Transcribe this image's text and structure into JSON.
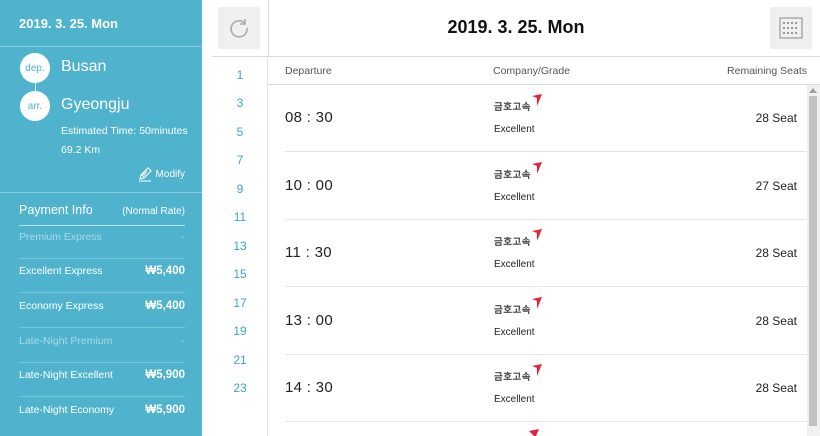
{
  "sidebar": {
    "date": "2019. 3. 25. Mon",
    "dep_badge": "dep.",
    "departure": "Busan",
    "arr_badge": "arr.",
    "arrival": "Gyeongju",
    "estimated_time": "Estimated Time: 50minutes",
    "distance": "69.2 Km",
    "modify_label": "Modify",
    "payment_title": "Payment Info",
    "rate_label": "(Normal Rate)",
    "fares": [
      {
        "name": "Premium Express",
        "price": "-"
      },
      {
        "name": "Excellent Express",
        "price": "₩5,400"
      },
      {
        "name": "Economy Express",
        "price": "₩5,400"
      },
      {
        "name": "Late-Night Premium",
        "price": "-"
      },
      {
        "name": "Late-Night Excellent",
        "price": "₩5,900"
      },
      {
        "name": "Late-Night Economy",
        "price": "₩5,900"
      }
    ]
  },
  "header": {
    "title": "2019. 3. 25. Mon"
  },
  "hours": [
    "1",
    "3",
    "5",
    "7",
    "9",
    "11",
    "13",
    "15",
    "17",
    "19",
    "21",
    "23"
  ],
  "table": {
    "col_departure": "Departure",
    "col_company": "Company/Grade",
    "col_seats": "Remaining Seats",
    "rows": [
      {
        "time": "08 : 30",
        "company": "금호고속",
        "grade": "Excellent",
        "seats": "28 Seat"
      },
      {
        "time": "10 : 00",
        "company": "금호고속",
        "grade": "Excellent",
        "seats": "27 Seat"
      },
      {
        "time": "11 : 30",
        "company": "금호고속",
        "grade": "Excellent",
        "seats": "28 Seat"
      },
      {
        "time": "13 : 00",
        "company": "금호고속",
        "grade": "Excellent",
        "seats": "28 Seat"
      },
      {
        "time": "14 : 30",
        "company": "금호고속",
        "grade": "Excellent",
        "seats": "28 Seat"
      }
    ]
  },
  "colors": {
    "sidebar_bg": "#4fb3ce",
    "hour_link": "#3aa6c6",
    "logo_accent": "#e8213a"
  }
}
